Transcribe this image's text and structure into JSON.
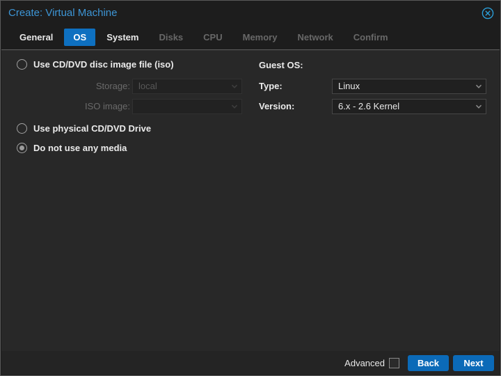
{
  "dialog": {
    "title": "Create: Virtual Machine"
  },
  "tabs": [
    {
      "label": "General",
      "state": "enabled"
    },
    {
      "label": "OS",
      "state": "active"
    },
    {
      "label": "System",
      "state": "enabled"
    },
    {
      "label": "Disks",
      "state": "disabled"
    },
    {
      "label": "CPU",
      "state": "disabled"
    },
    {
      "label": "Memory",
      "state": "disabled"
    },
    {
      "label": "Network",
      "state": "disabled"
    },
    {
      "label": "Confirm",
      "state": "disabled"
    }
  ],
  "os_panel": {
    "radio_options": [
      {
        "label": "Use CD/DVD disc image file (iso)",
        "selected": false
      },
      {
        "label": "Use physical CD/DVD Drive",
        "selected": false
      },
      {
        "label": "Do not use any media",
        "selected": true
      }
    ],
    "fields": {
      "storage": {
        "label": "Storage:",
        "value": "local",
        "disabled": true
      },
      "iso_image": {
        "label": "ISO image:",
        "value": "",
        "disabled": true
      }
    },
    "guest_os": {
      "heading": "Guest OS:",
      "type": {
        "label": "Type:",
        "value": "Linux"
      },
      "version": {
        "label": "Version:",
        "value": "6.x - 2.6 Kernel"
      }
    }
  },
  "footer": {
    "advanced_label": "Advanced",
    "advanced_checked": false,
    "buttons": [
      {
        "label": "Back"
      },
      {
        "label": "Next"
      }
    ]
  },
  "icons": {
    "close": "circle-x-icon",
    "dropdown": "chevron-down-icon"
  },
  "colors": {
    "accent_blue": "#0e70c0",
    "button_blue": "#0b6ab8",
    "title_blue": "#3d95d5",
    "panel_bg": "#282828",
    "window_bg": "#1d1d1d"
  }
}
